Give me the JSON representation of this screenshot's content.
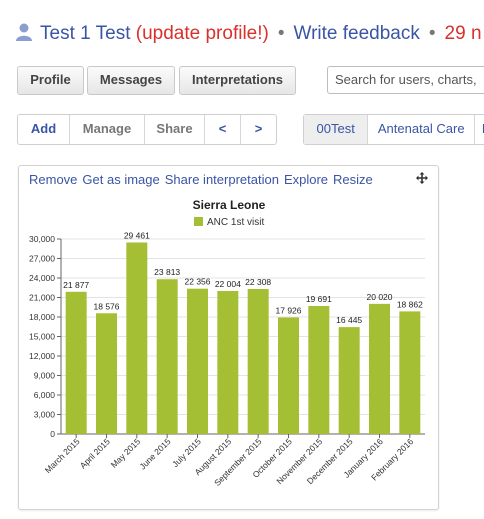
{
  "header": {
    "user_name": "Test 1 Test",
    "update_profile": "(update profile!)",
    "separator": "•",
    "write_feedback": "Write feedback",
    "messages_count": "29 n"
  },
  "toolbar": {
    "profile": "Profile",
    "messages": "Messages",
    "interpretations": "Interpretations",
    "search_placeholder": "Search for users, charts,"
  },
  "chart_toolbar": {
    "add": "Add",
    "manage": "Manage",
    "share": "Share",
    "prev": "<",
    "next": ">"
  },
  "tabs": [
    "00Test",
    "Antenatal Care",
    "I"
  ],
  "panel": {
    "remove": "Remove",
    "get_as_image": "Get as image",
    "share_interpretation": "Share interpretation",
    "explore": "Explore",
    "resize": "Resize"
  },
  "colors": {
    "accent": "#3a54a6",
    "alert": "#d9302b",
    "bar": "#a5bf35"
  },
  "chart_data": {
    "type": "bar",
    "title": "Sierra Leone",
    "legend": "top-center",
    "series": [
      {
        "name": "ANC 1st visit",
        "values": [
          21877,
          18576,
          29461,
          23813,
          22356,
          22004,
          22308,
          17926,
          19691,
          16445,
          20020,
          18862
        ]
      }
    ],
    "value_labels": [
      "21 877",
      "18 576",
      "29 461",
      "23 813",
      "22 356",
      "22 004",
      "22 308",
      "17 926",
      "19 691",
      "16 445",
      "20 020",
      "18 862"
    ],
    "categories": [
      "March 2015",
      "April 2015",
      "May 2015",
      "June 2015",
      "July 2015",
      "August 2015",
      "September 2015",
      "October 2015",
      "November 2015",
      "December 2015",
      "January 2016",
      "February 2016"
    ],
    "yticks": [
      "0",
      "3,000",
      "6,000",
      "9,000",
      "12,000",
      "15,000",
      "18,000",
      "21,000",
      "24,000",
      "27,000",
      "30,000"
    ],
    "ylim": [
      0,
      30000
    ],
    "grid": true
  }
}
